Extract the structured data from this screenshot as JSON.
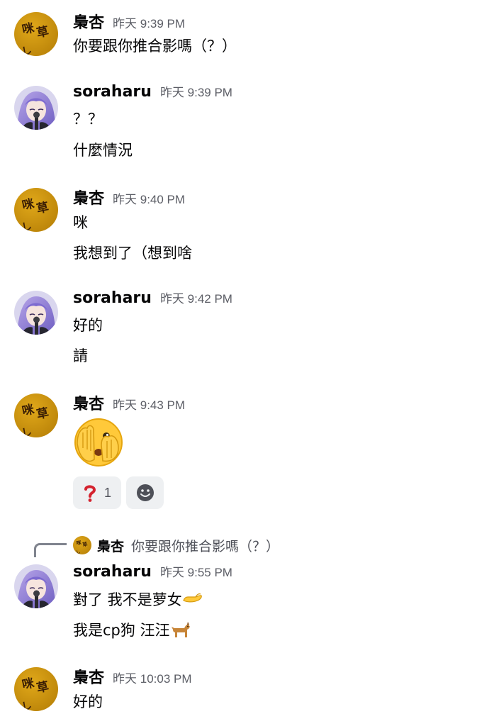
{
  "messages": [
    {
      "author": "梟杏",
      "avatar_icon": "cat-grass-avatar",
      "time": "昨天 9:39 PM",
      "lines": [
        "你要跟你推合影嗎（？）"
      ]
    },
    {
      "author": "soraharu",
      "avatar_icon": "anime-singer-avatar",
      "time": "昨天 9:39 PM",
      "lines": [
        "？？",
        "什麼情況"
      ]
    },
    {
      "author": "梟杏",
      "avatar_icon": "cat-grass-avatar",
      "time": "昨天 9:40 PM",
      "lines": [
        "咪",
        "我想到了（想到啥"
      ]
    },
    {
      "author": "soraharu",
      "avatar_icon": "anime-singer-avatar",
      "time": "昨天 9:42 PM",
      "lines": [
        "好的",
        "請"
      ]
    },
    {
      "author": "梟杏",
      "avatar_icon": "cat-grass-avatar",
      "time": "昨天 9:43 PM",
      "big_emoji": "face-with-open-eyes-and-hand-over-mouth-icon",
      "reactions": [
        {
          "emoji": "red-question-mark-icon",
          "count": "1"
        },
        {
          "emoji": "add-reaction-icon",
          "count": ""
        }
      ]
    },
    {
      "reply_to": {
        "author": "梟杏",
        "text": "你要跟你推合影嗎（？）"
      },
      "author": "soraharu",
      "avatar_icon": "anime-singer-avatar",
      "time": "昨天 9:55 PM",
      "lines": [
        "對了 我不是萝女",
        "我是cp狗 汪汪"
      ],
      "line_emojis": [
        "palm-up-hand-icon",
        "dog-icon"
      ]
    },
    {
      "author": "梟杏",
      "avatar_icon": "cat-grass-avatar",
      "time": "昨天 10:03 PM",
      "lines": [
        "好的"
      ]
    }
  ],
  "colors": {
    "background": "#ffffff",
    "username": "#060607",
    "timestamp": "#5c5e66",
    "reaction_bg": "#eef0f2",
    "reply_line": "#80848e"
  }
}
